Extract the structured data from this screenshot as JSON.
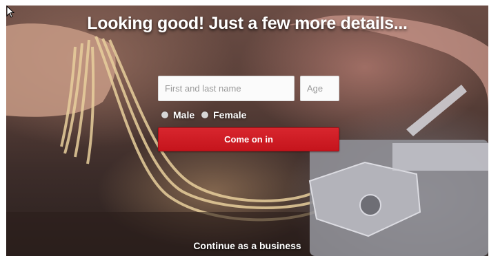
{
  "header": {
    "title": "Looking good! Just a few more details..."
  },
  "form": {
    "name_placeholder": "First and last name",
    "name_value": "",
    "age_placeholder": "Age",
    "age_value": "",
    "gender_options": [
      {
        "label": "Male",
        "icon": "radio-unselected-icon"
      },
      {
        "label": "Female",
        "icon": "radio-unselected-icon"
      }
    ],
    "submit_label": "Come on in"
  },
  "footer": {
    "business_link": "Continue as a business"
  },
  "colors": {
    "accent": "#cb1f27",
    "text": "#ffffff",
    "field_bg": "#fbfbfb"
  }
}
